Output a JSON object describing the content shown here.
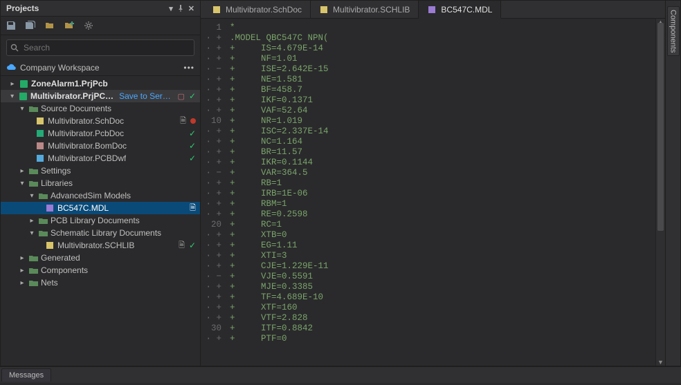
{
  "panel": {
    "title": "Projects"
  },
  "search": {
    "placeholder": "Search"
  },
  "workspace": {
    "label": "Company Workspace"
  },
  "tree": {
    "project1": "ZoneAlarm1.PrjPcb",
    "project2": "Multivibrator.PrjPCB *",
    "save_to_server": "Save to Server",
    "source_docs": "Source Documents",
    "schdoc": "Multivibrator.SchDoc",
    "pcbdoc": "Multivibrator.PcbDoc",
    "bomdoc": "Multivibrator.BomDoc",
    "pcbdwf": "Multivibrator.PCBDwf",
    "settings": "Settings",
    "libraries": "Libraries",
    "advsim": "AdvancedSim Models",
    "bc547c": "BC547C.MDL",
    "pcblib": "PCB Library Documents",
    "schlib_folder": "Schematic Library Documents",
    "schlib_file": "Multivibrator.SCHLIB",
    "generated": "Generated",
    "components": "Components",
    "nets": "Nets"
  },
  "tabs": {
    "t1": "Multivibrator.SchDoc",
    "t2": "Multivibrator.SCHLIB",
    "t3": "BC547C.MDL"
  },
  "right_dock": {
    "components": "Components"
  },
  "bottom": {
    "messages": "Messages"
  },
  "code": {
    "lines": [
      "*",
      ".MODEL QBC547C NPN(",
      "+     IS=4.679E-14",
      "+     NF=1.01",
      "+     ISE=2.642E-15",
      "+     NE=1.581",
      "+     BF=458.7",
      "+     IKF=0.1371",
      "+     VAF=52.64",
      "+     NR=1.019",
      "+     ISC=2.337E-14",
      "+     NC=1.164",
      "+     BR=11.57",
      "+     IKR=0.1144",
      "+     VAR=364.5",
      "+     RB=1",
      "+     IRB=1E-06",
      "+     RBM=1",
      "+     RE=0.2598",
      "+     RC=1",
      "+     XTB=0",
      "+     EG=1.11",
      "+     XTI=3",
      "+     CJE=1.229E-11",
      "+     VJE=0.5591",
      "+     MJE=0.3385",
      "+     TF=4.689E-10",
      "+     XTF=160",
      "+     VTF=2.828",
      "+     ITF=0.8842",
      "+     PTF=0"
    ],
    "gutter_sym": {
      "plus": "+",
      "minus": "−",
      "dot": "·"
    }
  }
}
